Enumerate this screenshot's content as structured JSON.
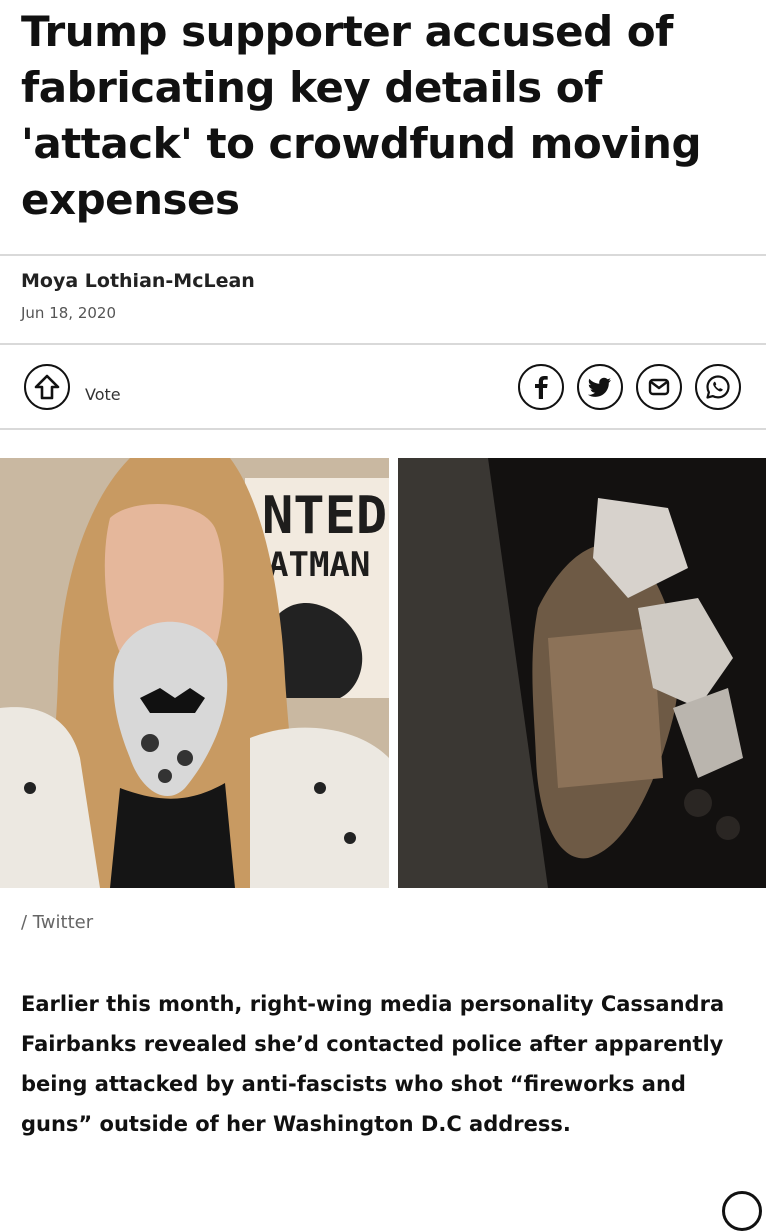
{
  "article": {
    "headline": "Trump supporter accused of fabricating key details of 'attack' to crowdfund moving expenses",
    "author": "Moya Lothian-McLean",
    "date": "Jun 18, 2020"
  },
  "actions": {
    "vote_label": "Vote",
    "share_icons": [
      "facebook-icon",
      "twitter-icon",
      "email-icon",
      "whatsapp-icon"
    ]
  },
  "media": {
    "left_photo_sign_text_1": "NTED",
    "left_photo_sign_text_2": "ATMAN",
    "caption": "/ Twitter"
  },
  "body": {
    "lede": "Earlier this month, right-wing media personality Cassandra Fairbanks revealed she’d contacted police after apparently being attacked by anti-fascists who shot “fireworks and guns” outside of her Washington D.C address."
  }
}
